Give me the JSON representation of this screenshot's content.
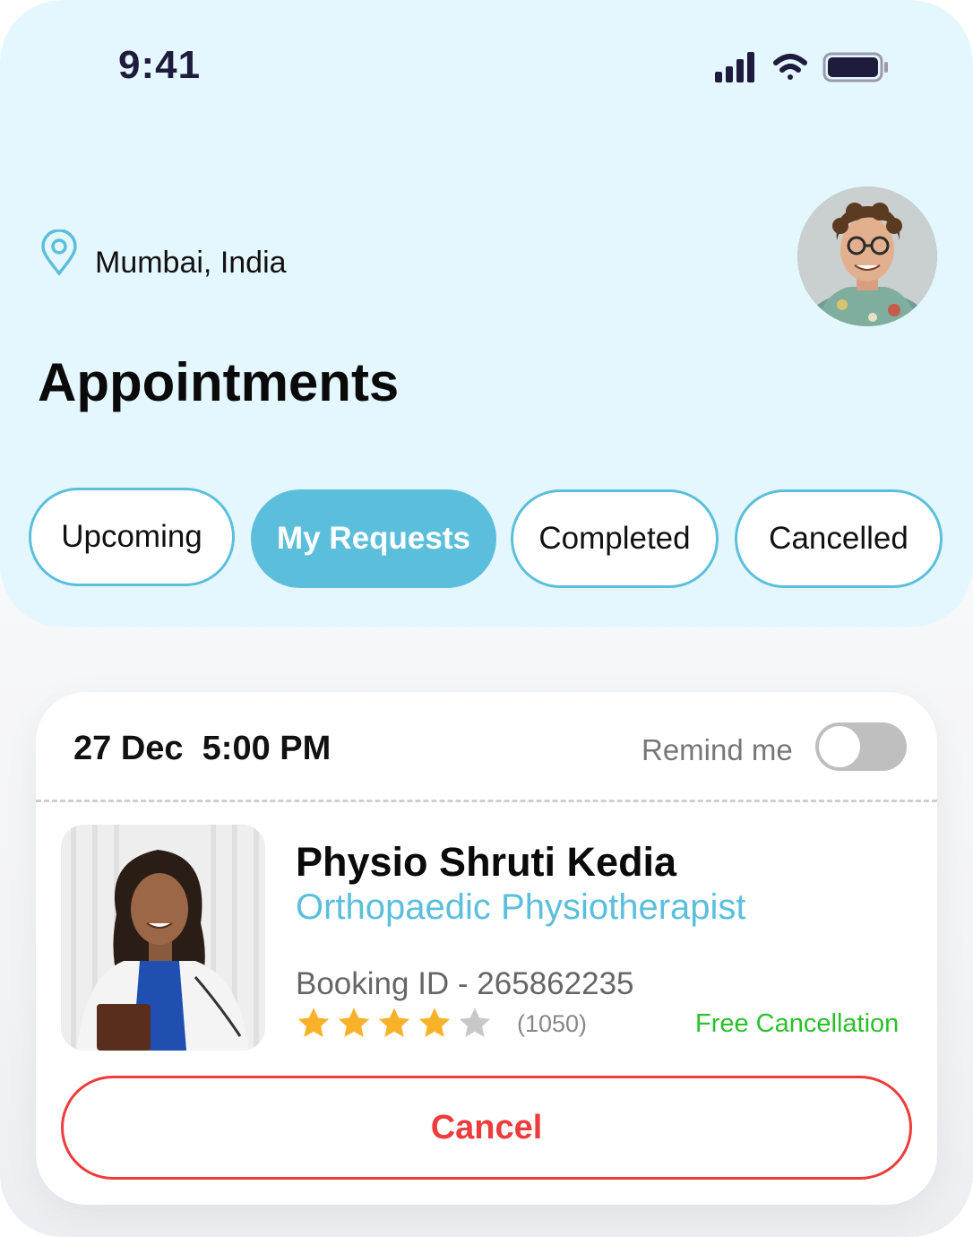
{
  "status_bar": {
    "time": "9:41",
    "icons": [
      "signal-icon",
      "wifi-icon",
      "battery-icon"
    ]
  },
  "header": {
    "location": "Mumbai, India",
    "title": "Appointments",
    "location_icon": "map-pin-icon"
  },
  "tabs": [
    {
      "label": "Upcoming",
      "active": false
    },
    {
      "label": "My Requests",
      "active": true
    },
    {
      "label": "Completed",
      "active": false
    },
    {
      "label": "Cancelled",
      "active": false
    }
  ],
  "appointment": {
    "date_time": "27 Dec  5:00 PM",
    "remind_label": "Remind me",
    "remind_enabled": false,
    "doctor_name": "Physio Shruti Kedia",
    "specialty": "Orthopaedic Physiotherapist",
    "booking_id": "Booking ID - 265862235",
    "rating": 4,
    "rating_max": 5,
    "review_count": "(1050)",
    "cancellation_policy": "Free Cancellation",
    "cancel_label": "Cancel"
  },
  "colors": {
    "header_bg": "#e5f7fe",
    "accent": "#5bbfdc",
    "cancel": "#ee3b3b",
    "success": "#2cc02c",
    "star": "#f7b22a"
  }
}
